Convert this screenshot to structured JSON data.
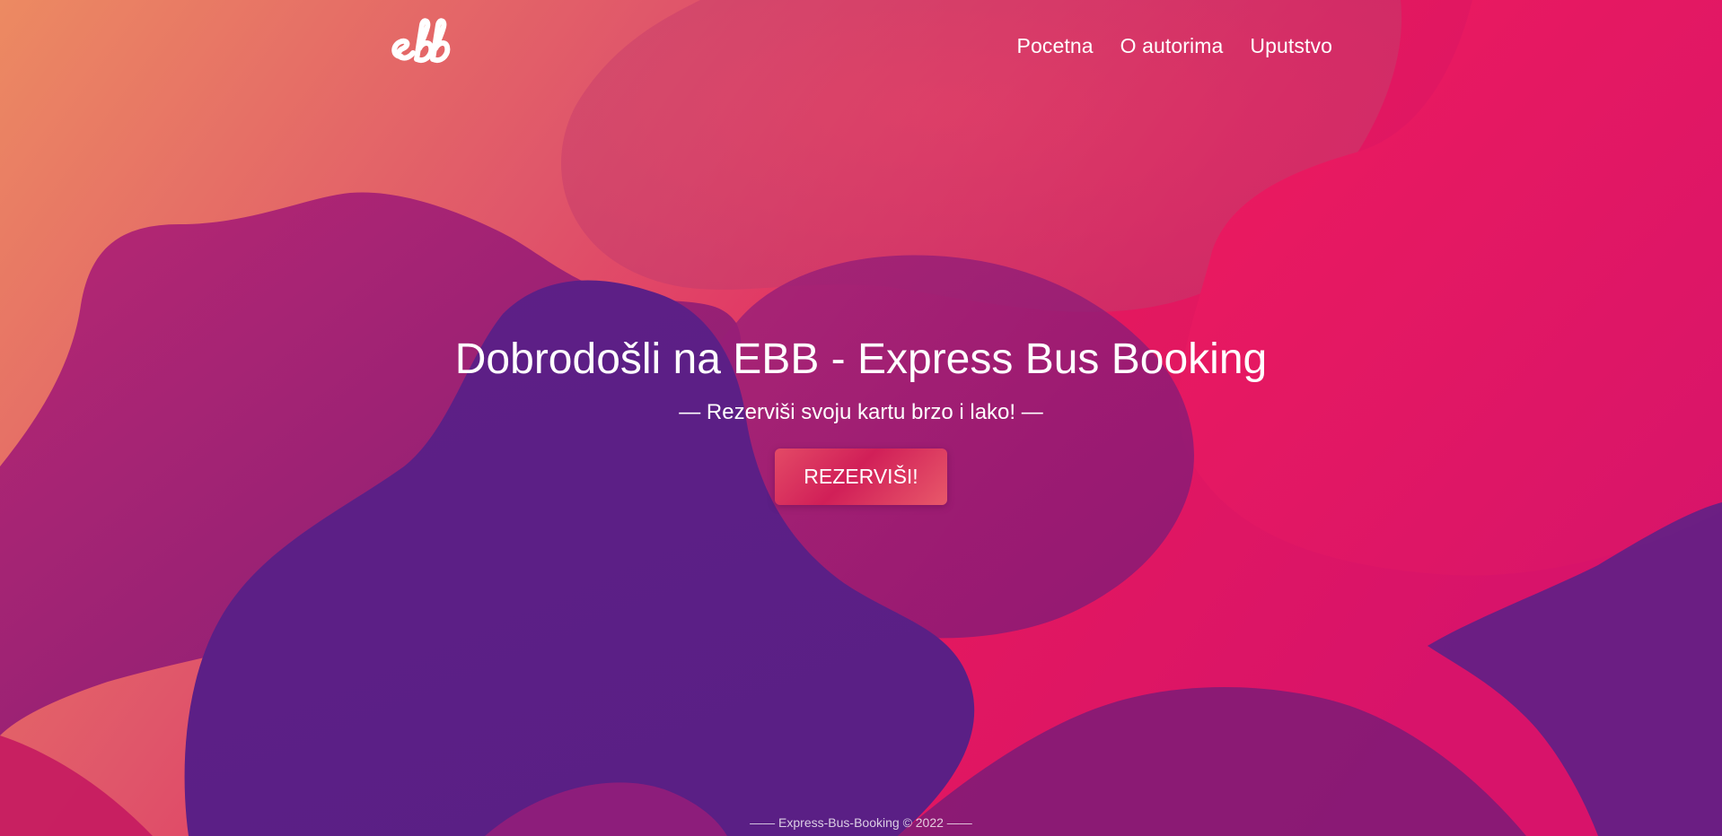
{
  "brand": {
    "logo_text": "ebb"
  },
  "nav": {
    "items": [
      {
        "label": "Pocetna"
      },
      {
        "label": "O autorima"
      },
      {
        "label": "Uputstvo"
      }
    ]
  },
  "hero": {
    "title": "Dobrodošli na EBB - Express Bus Booking",
    "subtitle": "— Rezerviši svoju kartu brzo i lako! —",
    "cta_label": "REZERVIŠI!"
  },
  "footer": {
    "text": "—— Express-Bus-Booking © 2022 ——"
  },
  "colors": {
    "peach": "#ec8a62",
    "coral": "#e14b68",
    "magenta": "#e01760",
    "plum": "#7b1a78",
    "violet": "#5b1f86",
    "button": "#d11f58",
    "text": "#ffffff"
  }
}
